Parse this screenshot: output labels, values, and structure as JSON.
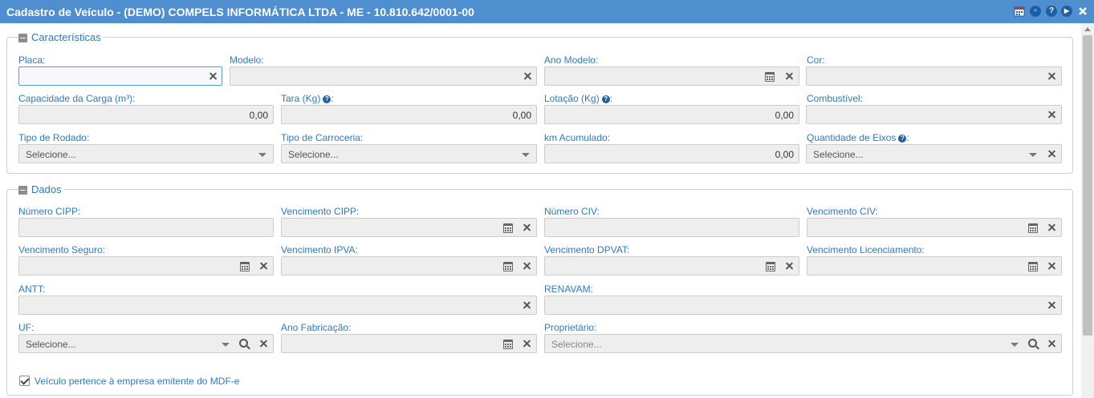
{
  "window": {
    "title": "Cadastro de Veículo - (DEMO) COMPELS INFORMÁTICA LTDA - ME - 10.810.642/0001-00",
    "header_color": "#4f8fd0",
    "icons": [
      "calendar-icon",
      "restore-icon",
      "help-icon",
      "play-icon",
      "close-icon"
    ]
  },
  "caracteristicas": {
    "legend": "Características",
    "placa": {
      "label": "Placa:",
      "value": ""
    },
    "modelo": {
      "label": "Modelo:",
      "value": ""
    },
    "ano_modelo": {
      "label": "Ano Modelo:",
      "value": ""
    },
    "cor": {
      "label": "Cor:",
      "value": ""
    },
    "capacidade": {
      "label": "Capacidade da Carga (m³):",
      "value": "0,00"
    },
    "tara": {
      "label": "Tara (Kg)",
      "suffix": ":",
      "value": "0,00"
    },
    "lotacao": {
      "label": "Lotação (Kg)",
      "suffix": ":",
      "value": "0,00"
    },
    "combustivel": {
      "label": "Combustível:",
      "value": ""
    },
    "tipo_rodado": {
      "label": "Tipo de Rodado:",
      "placeholder": "Selecione..."
    },
    "tipo_carroceria": {
      "label": "Tipo de Carroceria:",
      "placeholder": "Selecione..."
    },
    "km_acumulado": {
      "label": "km Acumulado:",
      "value": "0,00"
    },
    "qtd_eixos": {
      "label": "Quantidade de Eixos",
      "suffix": ":",
      "placeholder": "Selecione..."
    }
  },
  "dados": {
    "legend": "Dados",
    "numero_cipp": {
      "label": "Número CIPP:",
      "value": ""
    },
    "venc_cipp": {
      "label": "Vencimento CIPP:",
      "value": ""
    },
    "numero_civ": {
      "label": "Número CIV:",
      "value": ""
    },
    "venc_civ": {
      "label": "Vencimento CIV:",
      "value": ""
    },
    "venc_seguro": {
      "label": "Vencimento Seguro:",
      "value": ""
    },
    "venc_ipva": {
      "label": "Vencimento IPVA:",
      "value": ""
    },
    "venc_dpvat": {
      "label": "Vencimento DPVAT:",
      "value": ""
    },
    "venc_licenciamento": {
      "label": "Vencimento Licenciamento:",
      "value": ""
    },
    "antt": {
      "label": "ANTT:",
      "value": ""
    },
    "renavam": {
      "label": "RENAVAM:",
      "value": ""
    },
    "uf": {
      "label": "UF:",
      "placeholder": "Selecione..."
    },
    "ano_fabricacao": {
      "label": "Ano Fabricação:",
      "value": ""
    },
    "proprietario": {
      "label": "Proprietário:",
      "placeholder": "Selecione..."
    },
    "checkbox": {
      "label": "Veículo pertence à empresa emitente do MDF-e",
      "checked": true
    }
  }
}
